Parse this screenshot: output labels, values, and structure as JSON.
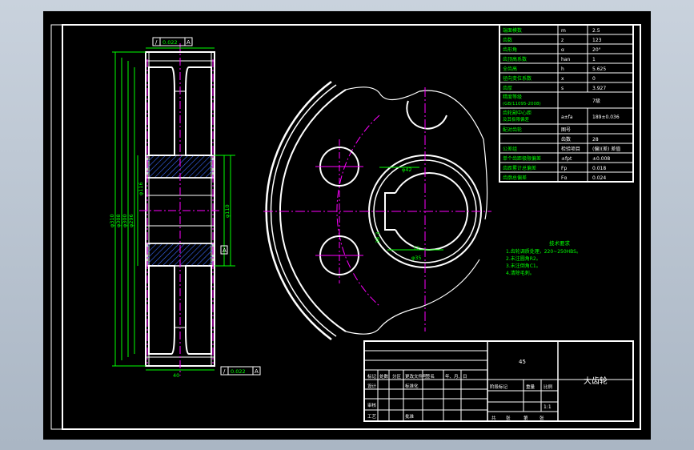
{
  "params_table": [
    {
      "label": "端面模数",
      "sym": "m",
      "val": "2.5"
    },
    {
      "label": "齿数",
      "sym": "z",
      "val": "123"
    },
    {
      "label": "齿形角",
      "sym": "α",
      "val": "20°"
    },
    {
      "label": "齿顶高系数",
      "sym": "han",
      "val": "1"
    },
    {
      "label": "全齿高",
      "sym": "h",
      "val": "5.625"
    },
    {
      "label": "径向变位系数",
      "sym": "x",
      "val": "0"
    },
    {
      "label": "齿厚",
      "sym": "s",
      "val": "3.927"
    },
    {
      "label": "精度等级",
      "sub": "(GB/11095-2008)",
      "sym": "",
      "val": "7级"
    },
    {
      "label": "齿轮副中心距",
      "sub": "及其极限偏差",
      "sym": "a±fa",
      "val": "189±0.036"
    },
    {
      "label": "配对齿轮",
      "sym": "图号",
      "val": ""
    },
    {
      "label": "",
      "sym": "齿数",
      "val": "28"
    },
    {
      "label": "公差组",
      "sym": "检验项目",
      "val": "(偏)(差) 差值"
    },
    {
      "label": "单个齿距极限偏差",
      "sym": "±fpt",
      "val": "±0.008"
    },
    {
      "label": "齿距累计总偏差",
      "sym": "Fp",
      "val": "0.018"
    },
    {
      "label": "齿廓总偏差",
      "sym": "Fα",
      "val": "0.024"
    }
  ],
  "tech_req": {
    "title": "技术要求",
    "lines": [
      "1.齿轮调质处理，220~250HBS。",
      "2.未注圆角R2。",
      "3.未注倒角C1。",
      "4.清除毛刺。"
    ]
  },
  "title_block": {
    "material": "45",
    "part_name": "大齿轮",
    "row1": [
      "标记",
      "处数",
      "分区",
      "更改文件号",
      "签名",
      "年、月、日"
    ],
    "row2": [
      "设计",
      "标准化",
      "阶段标记",
      "重量",
      "比例"
    ],
    "row3": [
      "审核"
    ],
    "row4": [
      "工艺",
      "批准"
    ],
    "scale": "1:1",
    "sheet": [
      "共",
      "张",
      "第",
      "张"
    ]
  },
  "dims": {
    "tol1": "0.022",
    "tol2": "0.022",
    "ref": "A",
    "width": "40",
    "d1": "φ310",
    "d2": "φ308",
    "d3": "φ300",
    "d4": "φ296",
    "d5": "φ116",
    "d6": "φ110",
    "hub": "φ42",
    "bore": "φ35",
    "key": "12",
    "keyh": "38.3"
  }
}
